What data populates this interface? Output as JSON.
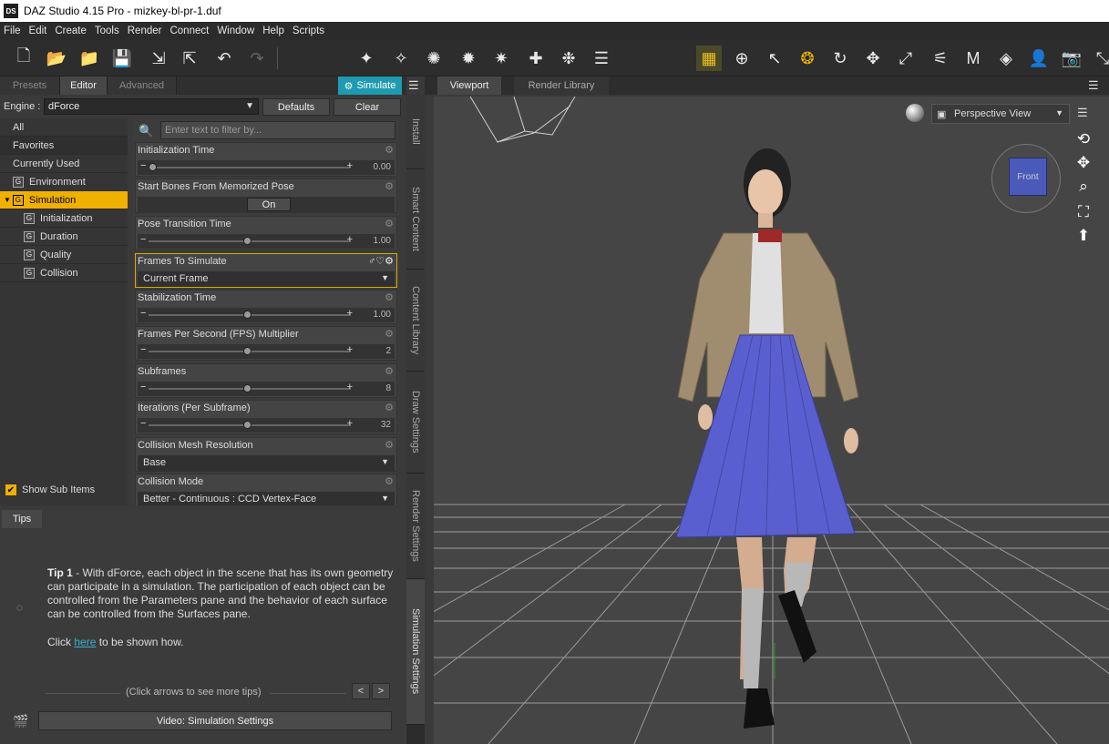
{
  "window": {
    "title": "DAZ Studio 4.15 Pro - mizkey-bl-pr-1.duf",
    "app_icon": "DS"
  },
  "menu": [
    "File",
    "Edit",
    "Create",
    "Tools",
    "Render",
    "Connect",
    "Window",
    "Help",
    "Scripts"
  ],
  "left_tabs": [
    "Presets",
    "Editor",
    "Advanced"
  ],
  "simulate_button": "Simulate",
  "engine": {
    "label": "Engine :",
    "value": "dForce",
    "defaults_label": "Defaults",
    "clear_label": "Clear"
  },
  "tree": [
    {
      "label": "All",
      "type": "plain",
      "selected": false
    },
    {
      "label": "Favorites",
      "type": "plain",
      "selected": false
    },
    {
      "label": "Currently Used",
      "type": "plain",
      "selected": false
    },
    {
      "label": "Environment",
      "type": "group",
      "selected": false
    },
    {
      "label": "Simulation",
      "type": "group",
      "selected": true
    },
    {
      "label": "Initialization",
      "type": "subgroup",
      "selected": false
    },
    {
      "label": "Duration",
      "type": "subgroup",
      "selected": false
    },
    {
      "label": "Quality",
      "type": "subgroup",
      "selected": false
    },
    {
      "label": "Collision",
      "type": "subgroup",
      "selected": false
    }
  ],
  "show_sub_items": "Show Sub Items",
  "filter_placeholder": "Enter text to filter by...",
  "params": [
    {
      "name": "Initialization Time",
      "kind": "slider",
      "value": "0.00",
      "fraction": 0.0
    },
    {
      "name": "Start Bones From Memorized Pose",
      "kind": "toggle",
      "value": "On"
    },
    {
      "name": "Pose Transition Time",
      "kind": "slider",
      "value": "1.00",
      "fraction": 0.5
    },
    {
      "name": "Frames To Simulate",
      "kind": "dropdown",
      "value": "Current Frame",
      "focused": true
    },
    {
      "name": "Stabilization Time",
      "kind": "slider",
      "value": "1.00",
      "fraction": 0.5
    },
    {
      "name": "Frames Per Second (FPS) Multiplier",
      "kind": "slider",
      "value": "2",
      "fraction": 0.5
    },
    {
      "name": "Subframes",
      "kind": "slider",
      "value": "8",
      "fraction": 0.5
    },
    {
      "name": "Iterations (Per Subframe)",
      "kind": "slider",
      "value": "32",
      "fraction": 0.5
    },
    {
      "name": "Collision Mesh Resolution",
      "kind": "dropdown",
      "value": "Base"
    },
    {
      "name": "Collision Mode",
      "kind": "dropdown",
      "value": "Better - Continuous : CCD Vertex-Face"
    }
  ],
  "side_tabs": [
    "Install",
    "Smart Content",
    "Content Library",
    "Draw Settings",
    "Render Settings",
    "Simulation Settings"
  ],
  "tips": {
    "tab": "Tips",
    "tip_title": "Tip 1",
    "tip_body": " - With dForce, each object in the scene that has its own geometry can participate in a simulation. The participation of each object can be controlled from the Parameters pane and the behavior of each surface can be controlled from the Surfaces pane.",
    "click_prefix": "Click ",
    "click_link": "here",
    "click_suffix": " to be shown how.",
    "more_tips": "(Click arrows to see more tips)",
    "prev": "<",
    "next": ">",
    "video_button": "Video: Simulation Settings"
  },
  "viewport_tabs": [
    "Viewport",
    "Render Library"
  ],
  "viewport": {
    "view": "Perspective View",
    "nav_cube_face": "Front"
  },
  "colors": {
    "accent": "#f0b000",
    "simulate": "#1e9bb0",
    "link": "#3ab0d8",
    "skirt": "#5a5fcf",
    "jacket": "#a08c6e"
  }
}
